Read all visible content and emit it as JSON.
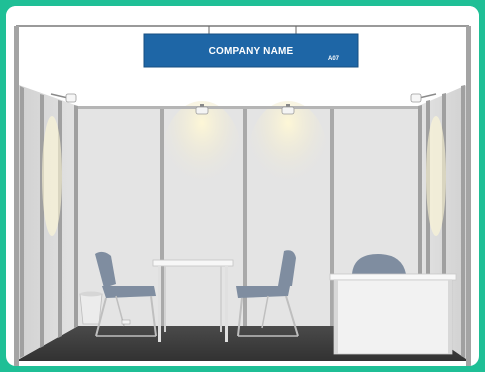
{
  "sign": {
    "company_name": "COMPANY NAME",
    "booth_code": "A07"
  },
  "colors": {
    "background": "#1fbf96",
    "sign_blue": "#1e66a6",
    "wall": "#e4e4e4",
    "floor": "#3c3c3c",
    "chair": "#7f8da0"
  }
}
